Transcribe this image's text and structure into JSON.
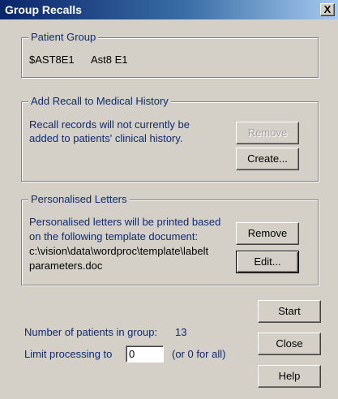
{
  "window": {
    "title": "Group Recalls",
    "close_label": "X"
  },
  "patient_group": {
    "legend": "Patient Group",
    "code": "$AST8E1",
    "name": "Ast8 E1"
  },
  "add_recall": {
    "legend": "Add Recall to Medical History",
    "message_line1": "Recall records will not currently be",
    "message_line2": "added to patients' clinical history.",
    "remove_label": "Remove",
    "create_label": "Create..."
  },
  "letters": {
    "legend": "Personalised Letters",
    "message_line1": "Personalised letters will be printed based",
    "message_line2": "on the following template document:",
    "path_line1": "c:\\vision\\data\\wordproc\\template\\labelt",
    "path_line2": "parameters.doc",
    "remove_label": "Remove",
    "edit_label": "Edit..."
  },
  "footer": {
    "patients_label": "Number of patients in group:",
    "patients_count": "13",
    "limit_label": "Limit processing to",
    "limit_value": "0",
    "limit_hint": "(or 0 for all)",
    "start_label": "Start",
    "close_label": "Close",
    "help_label": "Help"
  }
}
